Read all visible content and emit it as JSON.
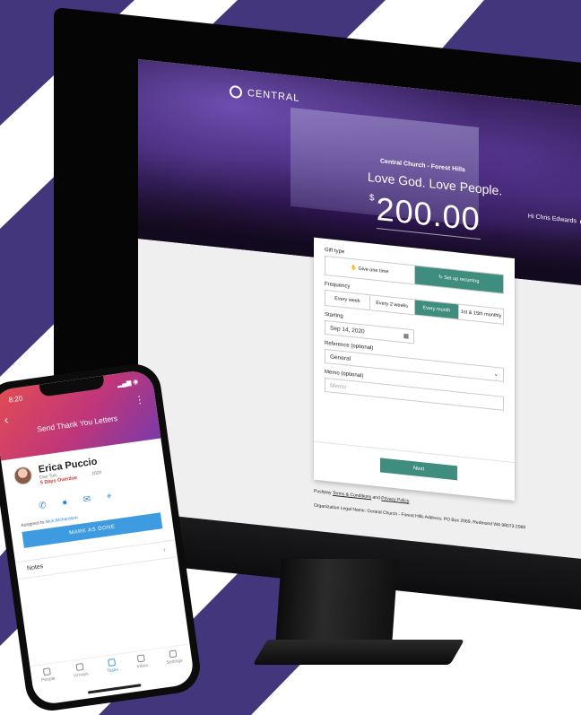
{
  "colors": {
    "stripe_purple": "#43367c",
    "accent_green": "#3e8d7e",
    "phone_blue": "#3f9be0",
    "overdue_red": "#dd3333"
  },
  "desktop": {
    "logo": "CENTRAL",
    "user_greeting": "Hi Chris Edwards",
    "church_name": "Central Church - Forest Hills",
    "tagline": "Love God. Love People.",
    "currency": "$",
    "amount": "200.00",
    "form": {
      "gift_type_label": "Gift type",
      "gift_types": [
        {
          "label": "Give one time",
          "icon": "hand-coin-icon",
          "active": false
        },
        {
          "label": "Set up recurring",
          "icon": "recurring-icon",
          "active": true
        }
      ],
      "frequency_label": "Frequency",
      "frequencies": [
        {
          "label": "Every week",
          "active": false
        },
        {
          "label": "Every 2 weeks",
          "active": false
        },
        {
          "label": "Every month",
          "active": true
        },
        {
          "label": "1st & 15th monthly",
          "active": false
        }
      ],
      "starting_label": "Starting",
      "starting_value": "Sep 14, 2020",
      "reference_label": "Reference (optional)",
      "reference_value": "General",
      "memo_label": "Memo (optional)",
      "memo_placeholder": "Memo",
      "next_button": "Next"
    },
    "footer_line1_prefix": "Pushpay",
    "footer_terms": "Terms & Conditions",
    "footer_and": "and",
    "footer_privacy": "Privacy Policy",
    "footer_line2": "Organization Legal Name: Central Church - Forest Hills      Address: PO Box 2069, Redmond WA 98073-2069"
  },
  "phone": {
    "status_time": "8:20",
    "status_right": "▂▄▆ ◉",
    "title": "Send Thank You Letters",
    "contact_name": "Erica Puccio",
    "contact_sub": "Due Tue, ...",
    "contact_date": "2020",
    "overdue": "5 Days Overdue",
    "assigned_prefix": "Assigned to",
    "assigned_name": "Nick Richardson",
    "mark_done": "MARK AS DONE",
    "notes_label": "Notes",
    "tabs": [
      {
        "label": "People",
        "active": false
      },
      {
        "label": "Groups",
        "active": false
      },
      {
        "label": "Tasks",
        "active": true
      },
      {
        "label": "Inbox",
        "active": false
      },
      {
        "label": "Settings",
        "active": false
      }
    ]
  }
}
